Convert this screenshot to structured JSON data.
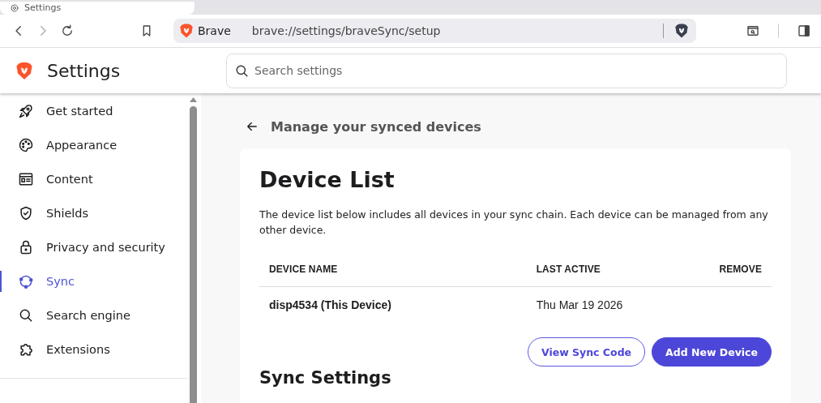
{
  "tab": {
    "title": "Settings"
  },
  "toolbar": {
    "site_label": "Brave",
    "url": "brave://settings/braveSync/setup"
  },
  "header": {
    "title": "Settings",
    "search": {
      "placeholder": "Search settings"
    }
  },
  "sidebar": {
    "items": [
      {
        "label": "Get started",
        "selected": false
      },
      {
        "label": "Appearance",
        "selected": false
      },
      {
        "label": "Content",
        "selected": false
      },
      {
        "label": "Shields",
        "selected": false
      },
      {
        "label": "Privacy and security",
        "selected": false
      },
      {
        "label": "Sync",
        "selected": true
      },
      {
        "label": "Search engine",
        "selected": false
      },
      {
        "label": "Extensions",
        "selected": false
      }
    ]
  },
  "page": {
    "back_title": "Manage your synced devices",
    "card": {
      "title": "Device List",
      "description": "The device list below includes all devices in your sync chain. Each device can be managed from any other device.",
      "table": {
        "columns": [
          "DEVICE NAME",
          "LAST ACTIVE",
          "REMOVE"
        ],
        "rows": [
          {
            "cells": [
              "disp4534 (This Device)",
              "Thu Mar 19 2026"
            ]
          }
        ]
      },
      "buttons": [
        {
          "label": "View Sync Code",
          "kind": "outline"
        },
        {
          "label": "Add New Device",
          "kind": "primary"
        }
      ],
      "next_section_title": "Sync Settings"
    }
  }
}
